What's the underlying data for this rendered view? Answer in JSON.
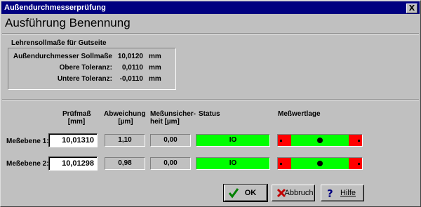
{
  "window": {
    "title": "Außendurchmesserprüfung",
    "close_label": "X"
  },
  "heading": "Ausführung Benennung",
  "reference": {
    "group_label": "Lehrensollmaße für Gutseite",
    "rows": [
      {
        "label": "Außendurchmesser Sollmaße",
        "value": "10,0120",
        "unit": "mm"
      },
      {
        "label": "Obere Toleranz:",
        "value": "0,0110",
        "unit": "mm"
      },
      {
        "label": "Untere Toleranz:",
        "value": "-0,0110",
        "unit": "mm"
      }
    ]
  },
  "columns": {
    "pruefmass": "Prüfmaß",
    "pruefmass_unit": "[mm]",
    "abweichung": "Abweichung",
    "abweichung_unit": "[µm]",
    "unsicherheit_1": "Meßunsicher-",
    "unsicherheit_2": "heit [µm]",
    "status": "Status",
    "lage": "Meßwertlage"
  },
  "rows": [
    {
      "label": "Meßebene 1:",
      "pruefmass": "10,01310",
      "abweichung": "1,10",
      "unsicherheit": "0,00",
      "status": "IO",
      "position": 0.5
    },
    {
      "label": "Meßebene 2:",
      "pruefmass": "10,01298",
      "abweichung": "0,98",
      "unsicherheit": "0,00",
      "status": "IO",
      "position": 0.5
    }
  ],
  "buttons": {
    "ok": "OK",
    "cancel": "Abbruch",
    "help": "Hilfe"
  },
  "colors": {
    "titlebar": "#000080",
    "ok_status": "#00ff00",
    "out_of_tolerance": "#ff0000"
  }
}
